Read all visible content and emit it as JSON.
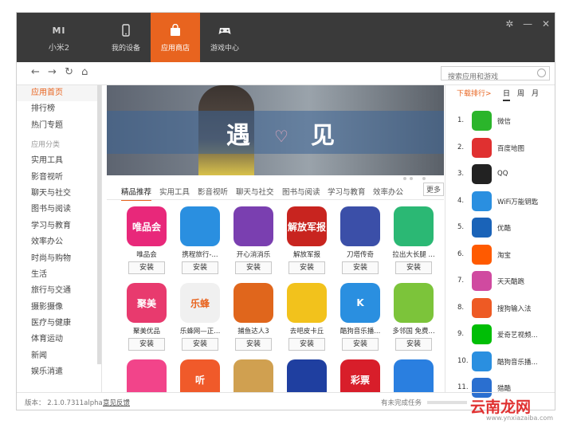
{
  "header": {
    "brand_logo": "MI",
    "brand_name": "小米2",
    "tabs": [
      {
        "label": "我的设备"
      },
      {
        "label": "应用商店"
      },
      {
        "label": "游戏中心"
      }
    ],
    "window_controls": [
      "✲",
      "—",
      "✕"
    ]
  },
  "toolbar": {
    "back": "←",
    "forward": "→",
    "refresh": "↻",
    "home": "⌂",
    "search_placeholder": "搜索应用和游戏"
  },
  "sidebar": {
    "items_top": [
      "应用首页",
      "排行榜",
      "热门专题"
    ],
    "category_caption": "应用分类",
    "categories": [
      "实用工具",
      "影音视听",
      "聊天与社交",
      "图书与阅读",
      "学习与教育",
      "效率办公",
      "时尚与购物",
      "生活",
      "旅行与交通",
      "摄影摄像",
      "医疗与健康",
      "体育运动",
      "新闻",
      "娱乐消遣"
    ]
  },
  "banner": {
    "text_left": "遇",
    "heart": "♡",
    "text_right": "见"
  },
  "categories_bar": {
    "tabs": [
      "精品推荐",
      "实用工具",
      "影音视听",
      "聊天与社交",
      "图书与阅读",
      "学习与教育",
      "效率办公"
    ],
    "more": "更多"
  },
  "apps": [
    {
      "name": "唯品会",
      "icon_text": "唯品会",
      "color": "#e8287a",
      "button": "安装"
    },
    {
      "name": "携程旅行-...",
      "icon_text": "",
      "color": "#2a8fe0",
      "button": "安装"
    },
    {
      "name": "开心消消乐",
      "icon_text": "",
      "color": "#7a3fb0",
      "button": "安装"
    },
    {
      "name": "解放军报",
      "icon_text": "解放军报",
      "color": "#c8241f",
      "button": "安装"
    },
    {
      "name": "刀塔传奇",
      "icon_text": "",
      "color": "#3b4fa8",
      "button": "安装"
    },
    {
      "name": "拉出大长腿 ...",
      "icon_text": "",
      "color": "#2bb874",
      "button": "安装"
    },
    {
      "name": "聚美优品",
      "icon_text": "聚美",
      "color": "#e83a6e",
      "button": "安装"
    },
    {
      "name": "乐蜂网—正...",
      "icon_text": "乐蜂",
      "color": "#f0f0f0",
      "button": "安装"
    },
    {
      "name": "捕鱼达人3",
      "icon_text": "",
      "color": "#e0661c",
      "button": "安装"
    },
    {
      "name": "去吧皮卡丘",
      "icon_text": "",
      "color": "#f2c21c",
      "button": "安装"
    },
    {
      "name": "酷狗音乐播...",
      "icon_text": "K",
      "color": "#2a8fe0",
      "button": "安装"
    },
    {
      "name": "多邻国 免费...",
      "icon_text": "",
      "color": "#7cc43a",
      "button": "安装"
    },
    {
      "name": "",
      "icon_text": "",
      "color": "#f2448a",
      "button": ""
    },
    {
      "name": "",
      "icon_text": "听",
      "color": "#f05a2a",
      "button": ""
    },
    {
      "name": "",
      "icon_text": "",
      "color": "#d0a050",
      "button": ""
    },
    {
      "name": "",
      "icon_text": "",
      "color": "#1f3fa0",
      "button": ""
    },
    {
      "name": "",
      "icon_text": "彩票",
      "color": "#d81e2a",
      "button": ""
    },
    {
      "name": "",
      "icon_text": "",
      "color": "#2a7fe0",
      "button": ""
    }
  ],
  "ranking": {
    "title": "下载排行>",
    "periods": [
      "日",
      "周",
      "月"
    ],
    "items": [
      {
        "rank": "1.",
        "name": "微信",
        "color": "#2bb52b"
      },
      {
        "rank": "2.",
        "name": "百度地图",
        "color": "#e03030"
      },
      {
        "rank": "3.",
        "name": "QQ",
        "color": "#222222"
      },
      {
        "rank": "4.",
        "name": "WiFi万能钥匙",
        "color": "#2a8fe0"
      },
      {
        "rank": "5.",
        "name": "优酷",
        "color": "#1a63b8"
      },
      {
        "rank": "6.",
        "name": "淘宝",
        "color": "#ff5a00"
      },
      {
        "rank": "7.",
        "name": "天天酷跑",
        "color": "#d04aa0"
      },
      {
        "rank": "8.",
        "name": "搜狗输入法",
        "color": "#ee5a24"
      },
      {
        "rank": "9.",
        "name": "爱奇艺视频...",
        "color": "#00be06"
      },
      {
        "rank": "10.",
        "name": "酷狗音乐播...",
        "color": "#2a8fe0"
      },
      {
        "rank": "11.",
        "name": "猎酷",
        "color": "#2a6fd0"
      }
    ]
  },
  "status": {
    "version": "版本： 2.1.0.7311alpha",
    "feedback": "意见反馈",
    "tasks": "有未完成任务"
  },
  "watermark": {
    "main": "云南龙网",
    "sub": "www.ynxiazaiba.com"
  },
  "colors": {
    "accent": "#e8641f",
    "header_bg": "#3a3a3a"
  }
}
